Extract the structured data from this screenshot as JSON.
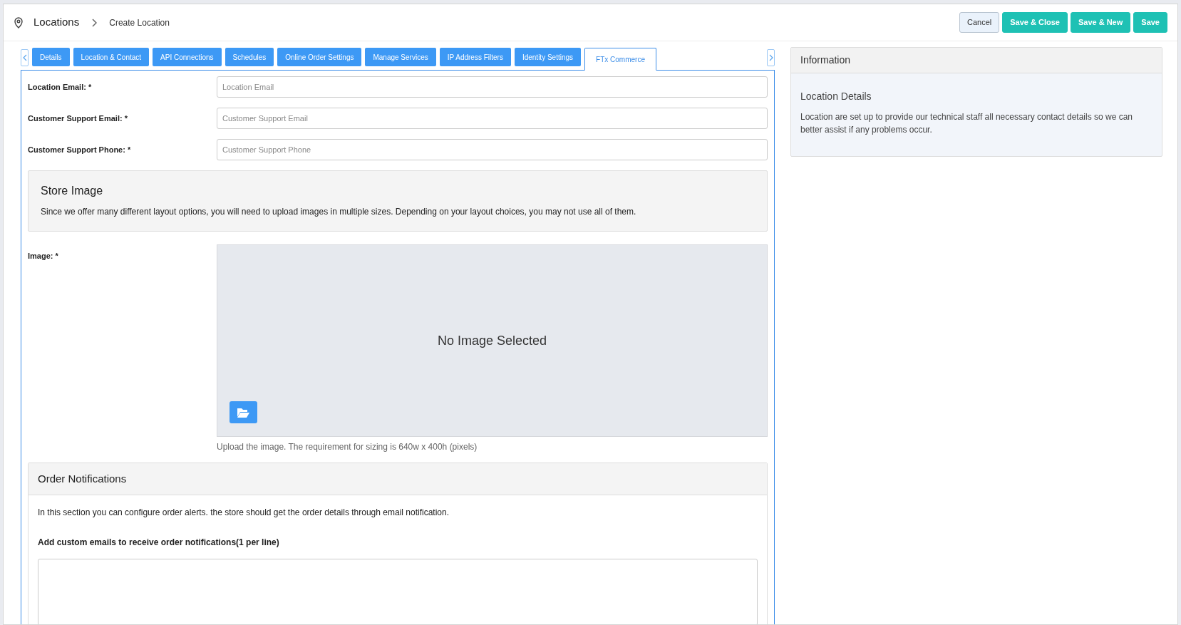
{
  "breadcrumb": {
    "title": "Locations",
    "current": "Create Location"
  },
  "actions": [
    {
      "label": "Cancel",
      "kind": "default"
    },
    {
      "label": "Save & Close",
      "kind": "primary"
    },
    {
      "label": "Save & New",
      "kind": "primary"
    },
    {
      "label": "Save",
      "kind": "primary"
    }
  ],
  "tabs": [
    {
      "label": "Details",
      "selected": false
    },
    {
      "label": "Location & Contact",
      "selected": false
    },
    {
      "label": "API Connections",
      "selected": false
    },
    {
      "label": "Schedules",
      "selected": false
    },
    {
      "label": "Online Order Settings",
      "selected": false
    },
    {
      "label": "Manage Services",
      "selected": false
    },
    {
      "label": "IP Address Filters",
      "selected": false
    },
    {
      "label": "Identity Settings",
      "selected": false
    },
    {
      "label": "FTx Commerce",
      "selected": true
    }
  ],
  "fields": [
    {
      "label": "Location Email: *",
      "placeholder": "Location Email"
    },
    {
      "label": "Customer Support Email: *",
      "placeholder": "Customer Support Email"
    },
    {
      "label": "Customer Support Phone: *",
      "placeholder": "Customer Support Phone"
    }
  ],
  "store_image": {
    "title": "Store Image",
    "text": "Since we offer many different layout options, you will need to upload images in multiple sizes. Depending on your layout choices, you may not use all of them.",
    "label": "Image: *",
    "empty_text": "No Image Selected",
    "help": "Upload the image. The requirement for sizing is 640w x 400h (pixels)"
  },
  "order_notifications": {
    "title": "Order Notifications",
    "text": "In this section you can configure order alerts. the store should get the order details through email notification.",
    "emails_label": "Add custom emails to receive order notifications(1 per line)"
  },
  "information": {
    "title": "Information",
    "heading": "Location Details",
    "text": "Location are set up to provide our technical staff all necessary contact details so we can better assist if any problems occur."
  }
}
